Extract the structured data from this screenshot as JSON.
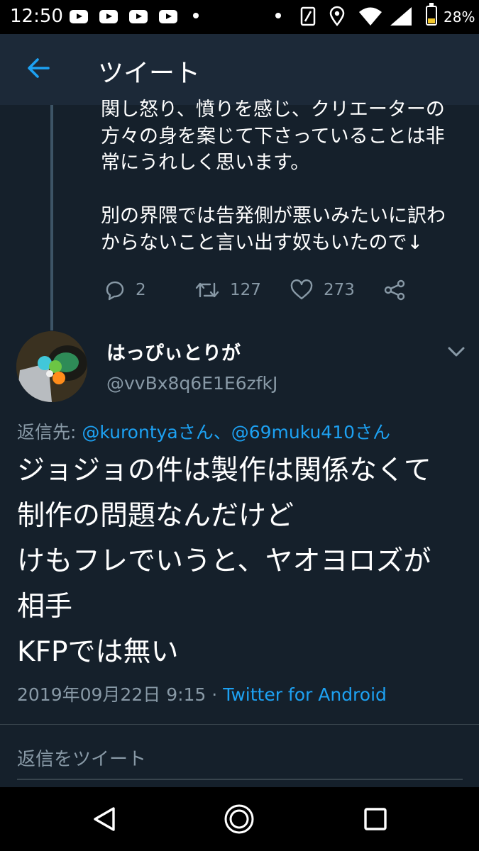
{
  "status_bar": {
    "time": "12:50",
    "battery_percent": "28%",
    "battery_level": 0.28,
    "icons": [
      "youtube-icon",
      "youtube-icon",
      "youtube-icon",
      "youtube-icon",
      "notification-dot-icon",
      "notification-dot-icon",
      "nfc-icon",
      "location-icon",
      "wifi-icon",
      "signal-icon",
      "battery-icon"
    ]
  },
  "header": {
    "title": "ツイート",
    "back_icon": "arrow-left-icon",
    "accent_color": "#1da1f2"
  },
  "previous_tweet": {
    "text": "関し怒り、憤りを感じ、クリエーターの\n方々の身を案じて下さっていることは非\n常にうれしく思います。\n\n別の界隈では告発側が悪いみたいに訳わ\nからないこと言い出す奴もいたので↓",
    "reply_count": "2",
    "retweet_count": "127",
    "like_count": "273"
  },
  "tweet": {
    "display_name": "はっぴぃとりが",
    "handle": "@vvBx8q6E1E6zfkJ",
    "reply_to_label": "返信先:",
    "reply_to_mentions": "@kurontyaさん、@69muku410さん",
    "body": "ジョジョの件は製作は関係なくて\n制作の問題なんだけど\nけもフレでいうと、ヤオヨロズが\n相手\nKFPでは無い",
    "timestamp": "2019年09月22日 9:15 · ",
    "client": "Twitter for Android"
  },
  "reply_composer": {
    "placeholder": "返信をツイート"
  },
  "colors": {
    "background": "#15202b",
    "header": "#1c2938",
    "secondary_text": "#8899a6",
    "link": "#1da1f2"
  }
}
